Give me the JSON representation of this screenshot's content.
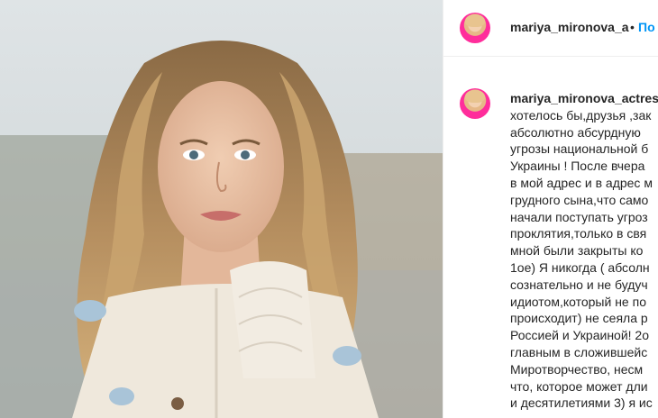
{
  "post": {
    "username": "mariya_mironova_a",
    "follow_label": "По"
  },
  "caption": {
    "username": "mariya_mironova_actres",
    "lines": [
      "хотелось бы,друзья ,зак",
      "абсолютно абсурдную",
      "угрозы национальной б",
      "Украины ! После вчера",
      "в мой адрес и в адрес м",
      "грудного сына,что само",
      "начали поступать угроз",
      "проклятия,только в свя",
      "мной были закрыты ко",
      "1ое) Я никогда ( абсолн",
      "сознательно и не будуч",
      "идиотом,который не по",
      "происходит) не сеяла р",
      "Россией и Украиной! 2о",
      "главным в сложившейс",
      "Миротворчество, несм",
      "что, которое может дли",
      "и десятилетиями 3) я ис"
    ]
  },
  "colors": {
    "link": "#0095f6",
    "text": "#262626",
    "divider": "#efefef"
  }
}
